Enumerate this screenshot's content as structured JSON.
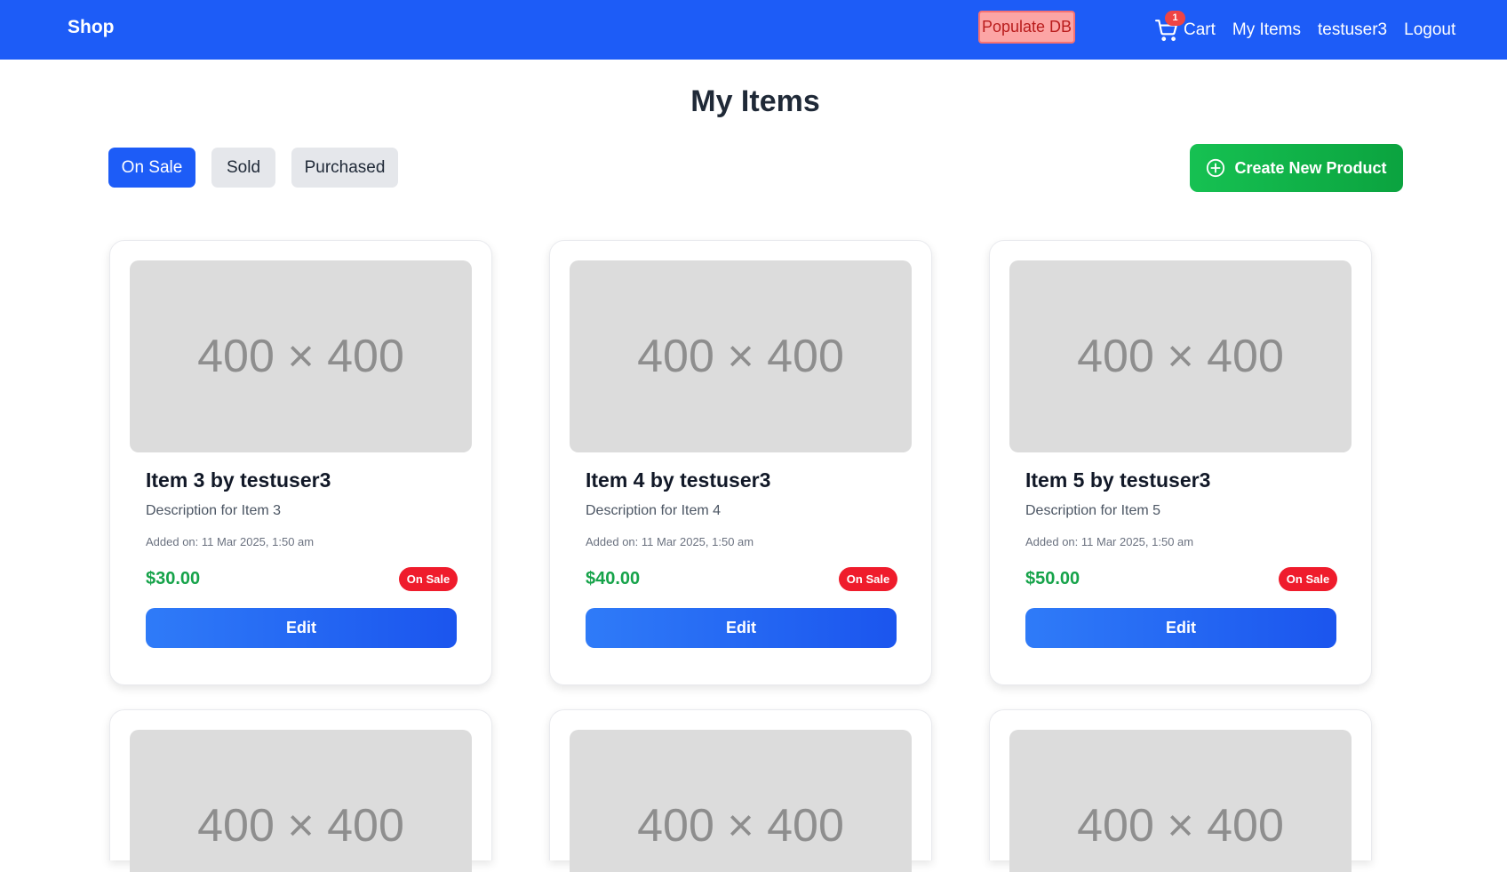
{
  "nav": {
    "brand": "Shop",
    "populate_label": "Populate DB",
    "cart_label": "Cart",
    "cart_count": "1",
    "my_items_label": "My Items",
    "username": "testuser3",
    "logout_label": "Logout"
  },
  "page": {
    "title": "My Items"
  },
  "tabs": [
    {
      "label": "On Sale",
      "active": true
    },
    {
      "label": "Sold",
      "active": false
    },
    {
      "label": "Purchased",
      "active": false
    }
  ],
  "create_label": "Create New Product",
  "items": [
    {
      "image_text": "400 × 400",
      "title": "Item 3 by testuser3",
      "description": "Description for Item 3",
      "added": "Added on: 11 Mar 2025, 1:50 am",
      "price": "$30.00",
      "badge": "On Sale",
      "edit_label": "Edit"
    },
    {
      "image_text": "400 × 400",
      "title": "Item 4 by testuser3",
      "description": "Description for Item 4",
      "added": "Added on: 11 Mar 2025, 1:50 am",
      "price": "$40.00",
      "badge": "On Sale",
      "edit_label": "Edit"
    },
    {
      "image_text": "400 × 400",
      "title": "Item 5 by testuser3",
      "description": "Description for Item 5",
      "added": "Added on: 11 Mar 2025, 1:50 am",
      "price": "$50.00",
      "badge": "On Sale",
      "edit_label": "Edit"
    }
  ],
  "partial_items": [
    {
      "image_text": "400 × 400"
    },
    {
      "image_text": "400 × 400"
    },
    {
      "image_text": "400 × 400"
    }
  ],
  "colors": {
    "primary": "#1d5cf7",
    "success": "#16a34a",
    "danger": "#ef1c2c"
  }
}
